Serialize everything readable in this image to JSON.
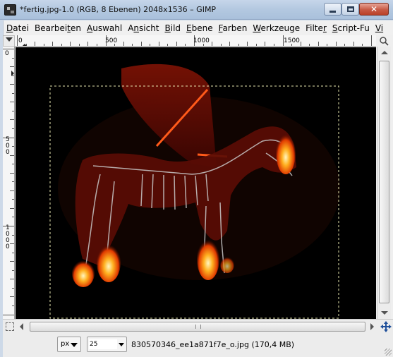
{
  "window": {
    "title": "*fertig.jpg-1.0 (RGB, 8 Ebenen) 2048x1536 – GIMP",
    "close_label": "✕"
  },
  "menu": {
    "items": [
      {
        "pre": "",
        "ul": "D",
        "post": "atei"
      },
      {
        "pre": "Bearbei",
        "ul": "t",
        "post": "en"
      },
      {
        "pre": "",
        "ul": "A",
        "post": "uswahl"
      },
      {
        "pre": "A",
        "ul": "n",
        "post": "sicht"
      },
      {
        "pre": "",
        "ul": "B",
        "post": "ild"
      },
      {
        "pre": "",
        "ul": "E",
        "post": "bene"
      },
      {
        "pre": "",
        "ul": "F",
        "post": "arben"
      },
      {
        "pre": "",
        "ul": "W",
        "post": "erkzeuge"
      },
      {
        "pre": "Filte",
        "ul": "r",
        "post": ""
      },
      {
        "pre": "",
        "ul": "S",
        "post": "cript-Fu"
      },
      {
        "pre": "",
        "ul": "Vi",
        "post": ""
      }
    ]
  },
  "rulers": {
    "horizontal_labels": [
      "0",
      "500",
      "1000",
      "1500"
    ],
    "vertical_labels": [
      "0",
      "500",
      "1000"
    ]
  },
  "status": {
    "unit": "px",
    "zoom": "25",
    "zoom_percent_glyph": "%",
    "info": "830570346_ee1a871f7e_o.jpg (170,4 MB)"
  },
  "colors": {
    "canvas_bg": "#000000",
    "selection_marching_ants": "#e8e8b0",
    "fire": "#ff9a1a"
  },
  "icons": {
    "app": "gimp-icon",
    "minimize": "minimize-icon",
    "maximize": "maximize-icon",
    "close": "close-icon",
    "navigate": "navigate-icon",
    "quick_mask": "quick-mask-icon",
    "zoom_on_resize": "zoom-on-resize-icon"
  }
}
